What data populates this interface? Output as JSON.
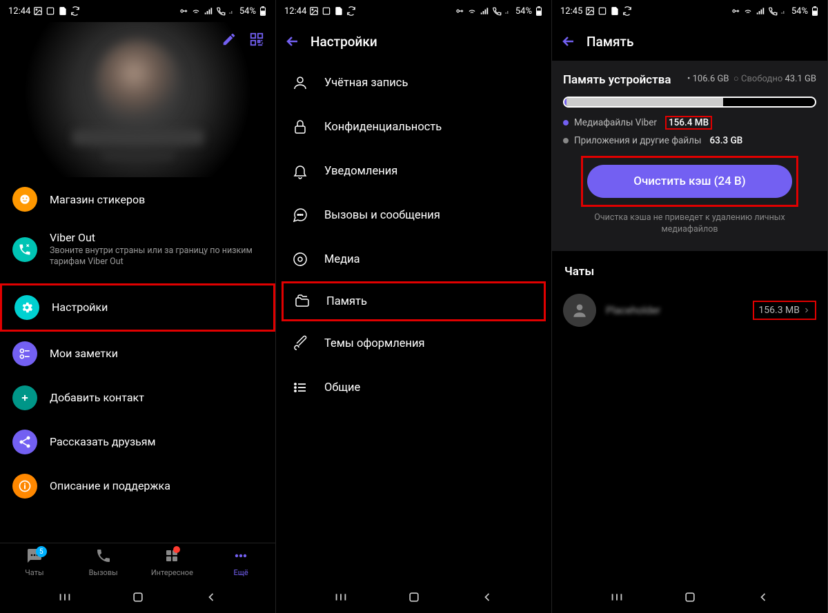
{
  "status": {
    "time1": "12:44",
    "time2": "12:44",
    "time3": "12:45",
    "battery": "54%"
  },
  "screen1": {
    "menu": {
      "stickers": "Магазин стикеров",
      "viber_out_title": "Viber Out",
      "viber_out_sub": "Звоните внутри страны или за границу по низким тарифам Viber Out",
      "settings": "Настройки",
      "notes": "Мои заметки",
      "add_contact": "Добавить контакт",
      "share": "Рассказать друзьям",
      "help": "Описание и поддержка"
    },
    "nav": {
      "chats": "Чаты",
      "calls": "Вызовы",
      "interesting": "Интересное",
      "more": "Ещё",
      "chats_badge": "5"
    }
  },
  "screen2": {
    "title": "Настройки",
    "items": {
      "account": "Учётная запись",
      "privacy": "Конфиденциальность",
      "notifications": "Уведомления",
      "calls": "Вызовы и сообщения",
      "media": "Медиа",
      "storage": "Память",
      "themes": "Темы оформления",
      "general": "Общие"
    }
  },
  "screen3": {
    "title": "Память",
    "device_storage_label": "Память устройства",
    "total": "106.6 GB",
    "free_label": "Свободно",
    "free": "43.1 GB",
    "legend_viber": "Медиафайлы Viber",
    "legend_viber_val": "156.4 MB",
    "legend_apps": "Приложения и другие файлы",
    "legend_apps_val": "63.3 GB",
    "clear_cache": "Очистить кэш (24 B)",
    "cache_note": "Очистка кэша не приведет к удалению личных медиафайлов",
    "chats_header": "Чаты",
    "chat_name": "Placeholder",
    "chat_size": "156.3 MB"
  }
}
